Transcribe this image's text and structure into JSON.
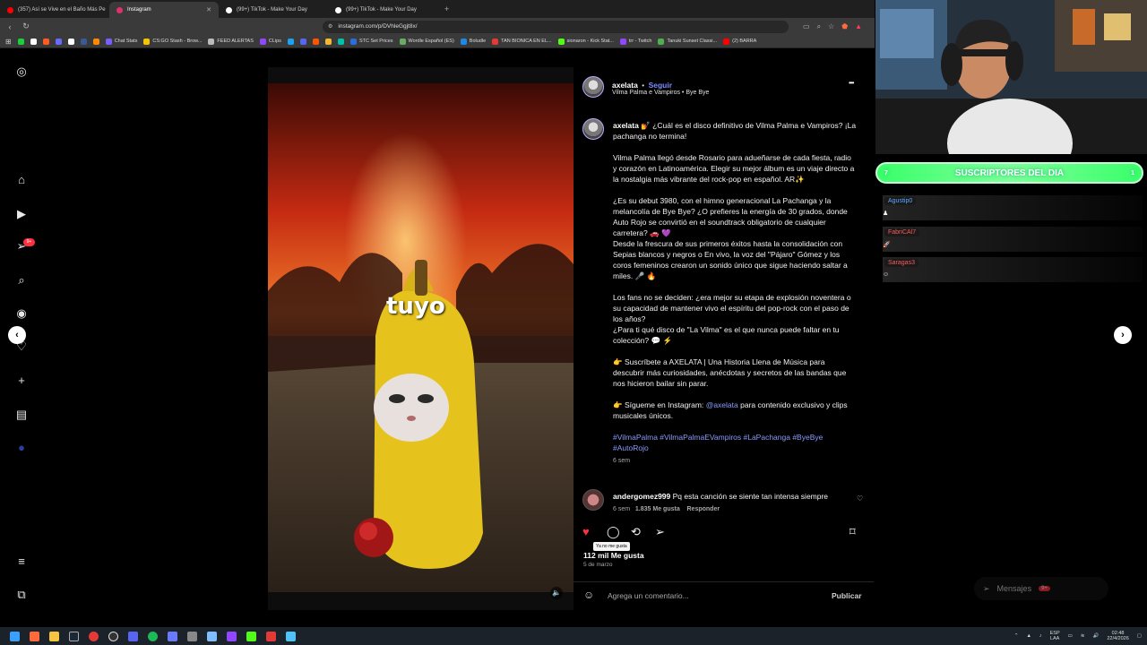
{
  "browser": {
    "tabs": [
      {
        "label": "(357) Así se Vive en el Baño Más Pe",
        "color": "#ff0000",
        "active": false
      },
      {
        "label": "Instagram",
        "color": "#e1306c",
        "active": true
      },
      {
        "label": "(99+) TikTok - Make Your Day",
        "color": "#ffffff",
        "active": false
      },
      {
        "label": "(99+) TikTok - Make Your Day",
        "color": "#ffffff",
        "active": false
      }
    ],
    "url": "instagram.com/p/DVhleGgjt8x/",
    "bookmarks": [
      {
        "label": "",
        "color": "#19d23a"
      },
      {
        "label": "",
        "color": "#ffffff"
      },
      {
        "label": "",
        "color": "#ff5a1f"
      },
      {
        "label": "",
        "color": "#6a6aff"
      },
      {
        "label": "",
        "color": "#ffffff"
      },
      {
        "label": "",
        "color": "#3b5998"
      },
      {
        "label": "",
        "color": "#ff8800"
      },
      {
        "label": "Chat Stats",
        "color": "#7a5cff"
      },
      {
        "label": "CS:GO Stash - Brow...",
        "color": "#f5c400"
      },
      {
        "label": "FEED ALERTAS",
        "color": "#bbbbbb"
      },
      {
        "label": "CLips",
        "color": "#9146ff"
      },
      {
        "label": "",
        "color": "#1da1f2"
      },
      {
        "label": "",
        "color": "#5865f2"
      },
      {
        "label": "",
        "color": "#ff5500"
      },
      {
        "label": "",
        "color": "#f3ba2f"
      },
      {
        "label": "",
        "color": "#00c2a8"
      },
      {
        "label": "STC Set Prices",
        "color": "#2d6cdf"
      },
      {
        "label": "Wordle Español (ES)",
        "color": "#6aaa64"
      },
      {
        "label": "Boludle",
        "color": "#1e88e5"
      },
      {
        "label": "TAN BIONICA EN EL...",
        "color": "#e53935"
      },
      {
        "label": "sionaron - Kick Stat...",
        "color": "#53fc18"
      },
      {
        "label": "trr - Twitch",
        "color": "#9146ff"
      },
      {
        "label": "Tanuki Sunset Classi...",
        "color": "#4caf50"
      },
      {
        "label": "(2) BARRA",
        "color": "#ff0000"
      }
    ]
  },
  "instagram": {
    "post": {
      "username": "axelata",
      "follow_label": "Seguir",
      "dot": "•",
      "audio": "Vilma Palma e Vampiros • Bye Bye",
      "more": "•••",
      "caption_user": "axelata",
      "caption": [
        "💅 ¿Cuál es el disco definitivo de Vilma Palma e Vampiros? ¡La pachanga no termina!",
        "Vilma Palma llegó desde Rosario para adueñarse de cada fiesta, radio y corazón en Latinoamérica. Elegir su mejor álbum es un viaje directo a la nostalgia más vibrante del rock-pop en español. AR✨",
        "¿Es su debut 3980, con el himno generacional La Pachanga y la melancolía de Bye Bye? ¿O prefieres la energía de 30 grados, donde Auto Rojo se convirtió en el soundtrack obligatorio de cualquier carretera? 🚗 💜",
        "Desde la frescura de sus primeros éxitos hasta la consolidación con Sepias blancos y negros o En vivo, la voz del \"Pájaro\" Gómez y los coros femeninos crearon un sonido único que sigue haciendo saltar a miles. 🎤 🔥",
        "Los fans no se deciden: ¿era mejor su etapa de explosión noventera o su capacidad de mantener vivo el espíritu del pop-rock con el paso de los años?",
        "¿Para ti qué disco de \"La Vilma\" es el que nunca puede faltar en tu colección? 💬 ⚡",
        "👉 Suscríbete a AXELATA | Una Historia Llena de Música para descubrir más curiosidades, anécdotas y secretos de las bandas que nos hicieron bailar sin parar."
      ],
      "follow_ig_prefix": "👉 Sígueme en Instagram:",
      "follow_ig_mention": "@axelata",
      "follow_ig_suffix": "para contenido exclusivo y clips musicales únicos.",
      "hashtags": "#VilmaPalma #VilmaPalmaEVampiros #LaPachanga #ByeBye #AutoRojo",
      "caption_time": "6 sem",
      "comment": {
        "user": "andergomez999",
        "text": "Pq esta canción se siente tan intensa siempre",
        "time": "6 sem",
        "likes": "1.835 Me gusta",
        "reply": "Responder"
      },
      "tooltip": "Ya no me gusta",
      "likes_count": "112 mil Me gusta",
      "date": "5 de marzo",
      "comment_placeholder": "Agrega un comentario...",
      "publish_label": "Publicar"
    },
    "video_text": "tuyo",
    "sidebar_badge": "9+",
    "messages_label": "Mensajes",
    "messages_badge": "9+"
  },
  "stream": {
    "subs_label": "SUSCRIPTORES DEL DIA",
    "subs_left": "7",
    "subs_right": "1",
    "chat": [
      {
        "name": "Agustip0",
        "color": "#5aa9ff"
      },
      {
        "name": "FabriCAl7",
        "color": "#ff5a5a"
      },
      {
        "name": "Saragas3",
        "color": "#ff5a5a"
      }
    ]
  },
  "taskbar": {
    "lang_top": "ESP",
    "lang_bottom": "LAA",
    "time": "02:48",
    "date": "22/4/2026"
  }
}
